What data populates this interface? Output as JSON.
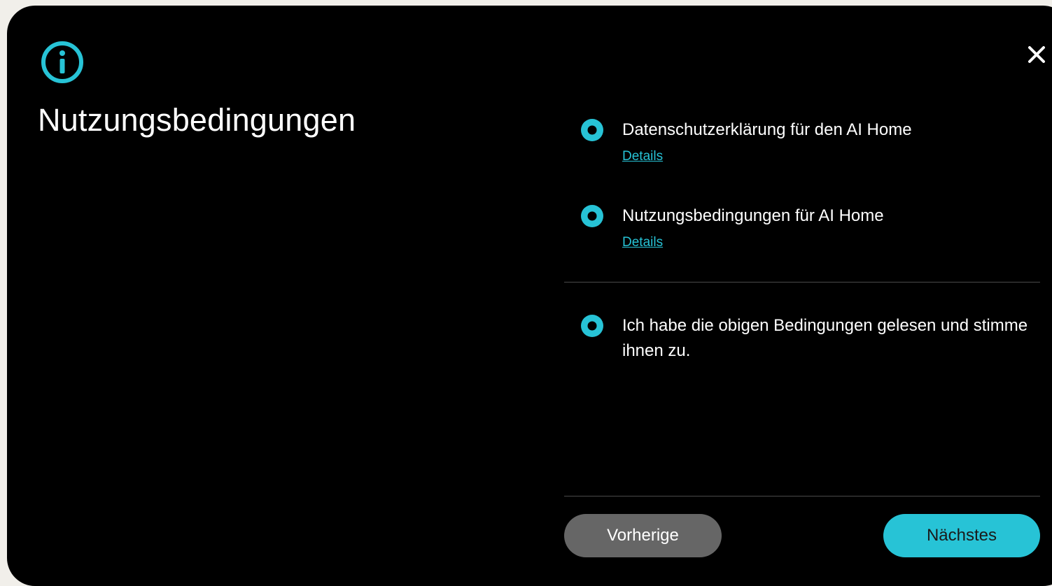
{
  "colors": {
    "accent": "#27c3d6",
    "background": "#000000",
    "secondary_button": "#666666",
    "page_backdrop": "#f1efea"
  },
  "header": {
    "info_icon": "info-circle-icon",
    "close_icon": "close-icon",
    "title": "Nutzungsbedingungen"
  },
  "options": [
    {
      "label": "Datenschutzerklärung für den AI Home",
      "details_label": "Details",
      "selected": true
    },
    {
      "label": "Nutzungsbedingungen für AI Home",
      "details_label": "Details",
      "selected": true
    }
  ],
  "agreement": {
    "label": "Ich habe die obigen Bedingungen gelesen und stimme ihnen zu.",
    "selected": true
  },
  "footer": {
    "prev_label": "Vorherige",
    "next_label": "Nächstes"
  }
}
